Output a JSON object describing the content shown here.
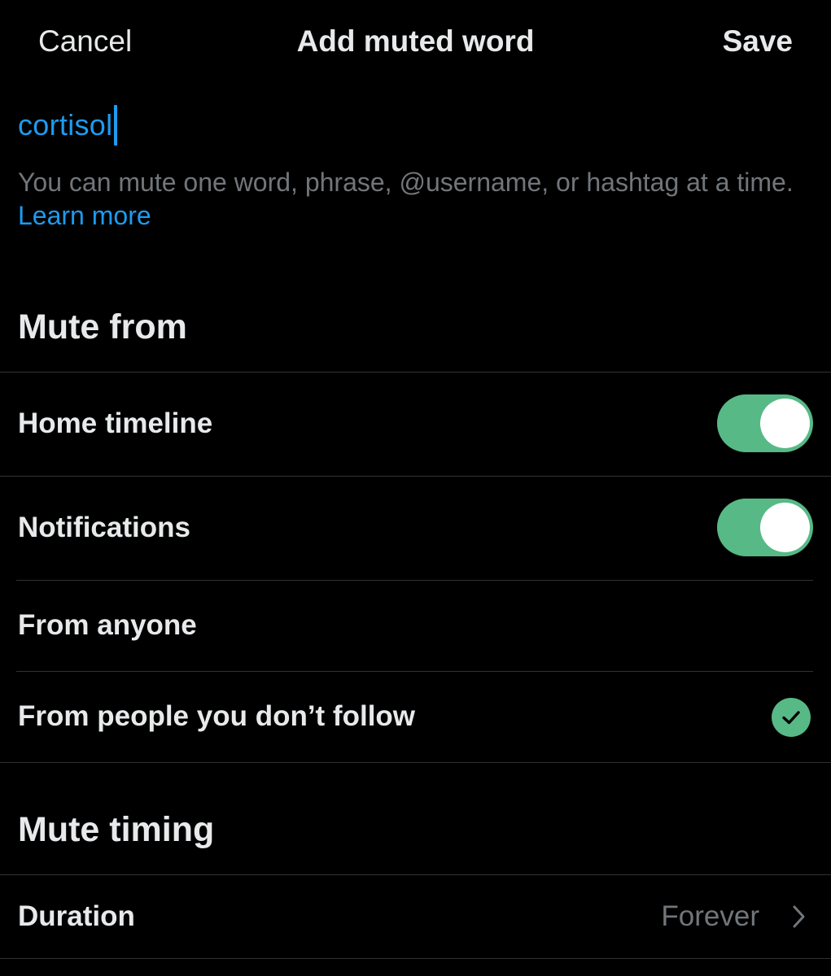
{
  "header": {
    "cancel_label": "Cancel",
    "title": "Add muted word",
    "save_label": "Save"
  },
  "input": {
    "value": "cortisol"
  },
  "helper": {
    "text": "You can mute one word, phrase, @username, or hashtag at a time. ",
    "link": "Learn more"
  },
  "mute_from": {
    "heading": "Mute from",
    "home_timeline": {
      "label": "Home timeline",
      "enabled": true
    },
    "notifications": {
      "label": "Notifications",
      "enabled": true
    },
    "from_anyone": {
      "label": "From anyone",
      "selected": false
    },
    "from_not_followed": {
      "label": "From people you don’t follow",
      "selected": true
    }
  },
  "mute_timing": {
    "heading": "Mute timing",
    "duration": {
      "label": "Duration",
      "value": "Forever"
    }
  },
  "icons": {
    "check": "checkmark-icon",
    "chevron": "chevron-right-icon"
  },
  "colors": {
    "background": "#000000",
    "text": "#e7e9ea",
    "muted_text": "#71767b",
    "accent_blue": "#1d9bf0",
    "toggle_green": "#57b986",
    "divider": "#2f3336"
  }
}
